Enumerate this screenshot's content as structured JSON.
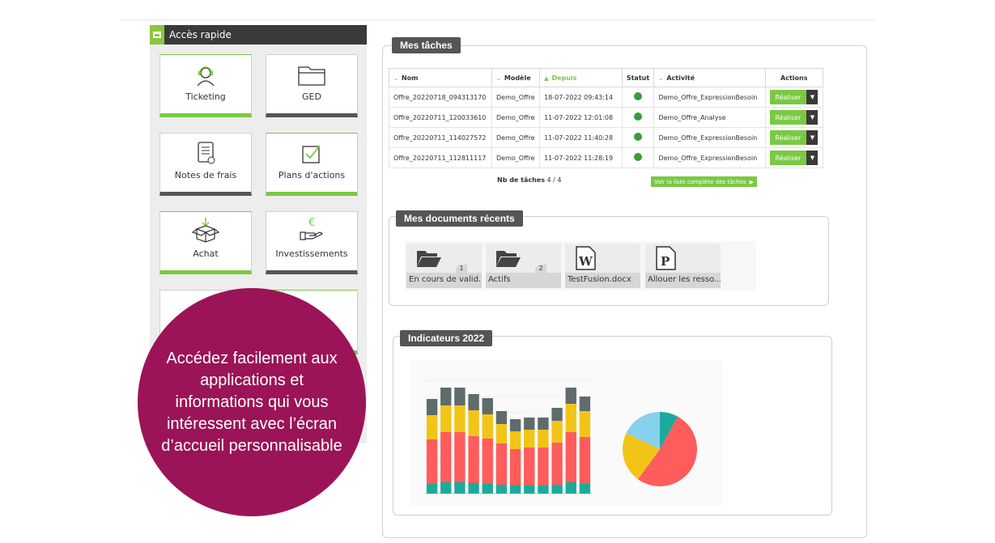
{
  "quick_access": {
    "title": "Accès rapide",
    "tiles": [
      {
        "label": "Ticketing",
        "icon": "headset-icon"
      },
      {
        "label": "GED",
        "icon": "folder-icon"
      },
      {
        "label": "Notes de frais",
        "icon": "receipt-icon"
      },
      {
        "label": "Plans d'actions",
        "icon": "checkbox-icon"
      },
      {
        "label": "Achat",
        "icon": "box-icon"
      },
      {
        "label": "Investissements",
        "icon": "euro-hand-icon"
      }
    ]
  },
  "promo": {
    "text": "Accédez facilement aux applications et informations qui vous intéressent avec l’écran d’accueil personnalisable"
  },
  "tasks": {
    "title": "Mes tâches",
    "columns": [
      "Nom",
      "Modèle",
      "Depuis",
      "Statut",
      "Activité",
      "Actions"
    ],
    "rows": [
      {
        "nom": "Offre_20220718_094313170",
        "modele": "Demo_Offre",
        "depuis": "18-07-2022 09:43:14",
        "activite": "Demo_Offre_ExpressionBesoin",
        "action": "Réaliser"
      },
      {
        "nom": "Offre_20220711_120033610",
        "modele": "Demo_Offre",
        "depuis": "11-07-2022 12:01:08",
        "activite": "Demo_Offre_Analyse",
        "action": "Réaliser"
      },
      {
        "nom": "Offre_20220711_114027572",
        "modele": "Demo_Offre",
        "depuis": "11-07-2022 11:40:28",
        "activite": "Demo_Offre_ExpressionBesoin",
        "action": "Réaliser"
      },
      {
        "nom": "Offre_20220711_112811117",
        "modele": "Demo_Offre",
        "depuis": "11-07-2022 11:28:19",
        "activite": "Demo_Offre_ExpressionBesoin",
        "action": "Réaliser"
      }
    ],
    "count_label": "Nb de tâches",
    "count_value": "4 / 4",
    "full_list_label": "Voir la liste complète des tâches",
    "status_color": "#3c9a3c",
    "accent": "#7ac943"
  },
  "documents": {
    "title": "Mes documents récents",
    "items": [
      {
        "label": "En cours de valid...",
        "count": "1",
        "icon": "open-folder-icon"
      },
      {
        "label": "Actifs",
        "count": "2",
        "icon": "open-folder-icon"
      },
      {
        "label": "TestFusion.docx",
        "count": "",
        "icon": "word-document-icon"
      },
      {
        "label": "Allouer les resso...",
        "count": "",
        "icon": "project-document-icon"
      }
    ]
  },
  "indicators": {
    "title": "Indicateurs 2022"
  },
  "chart_data": [
    {
      "type": "bar",
      "stacked": true,
      "series_colors": [
        "#1aab9b",
        "#ff5c5c",
        "#f2c418",
        "#5f6b6d"
      ],
      "series": [
        {
          "values": [
            12,
            14,
            14,
            13,
            12,
            11,
            10,
            10,
            10,
            11,
            14,
            12
          ]
        },
        {
          "values": [
            55,
            62,
            62,
            58,
            56,
            51,
            45,
            47,
            47,
            52,
            62,
            58
          ]
        },
        {
          "values": [
            30,
            33,
            33,
            32,
            30,
            24,
            22,
            22,
            22,
            27,
            35,
            32
          ]
        },
        {
          "values": [
            20,
            22,
            22,
            20,
            20,
            16,
            15,
            15,
            15,
            16,
            20,
            18
          ]
        }
      ],
      "ylim": [
        0,
        140
      ]
    },
    {
      "type": "pie",
      "colors": [
        "#1aab9b",
        "#ff5c5c",
        "#f2c418",
        "#87d1ee"
      ],
      "values": [
        8,
        52,
        22,
        18
      ]
    }
  ]
}
